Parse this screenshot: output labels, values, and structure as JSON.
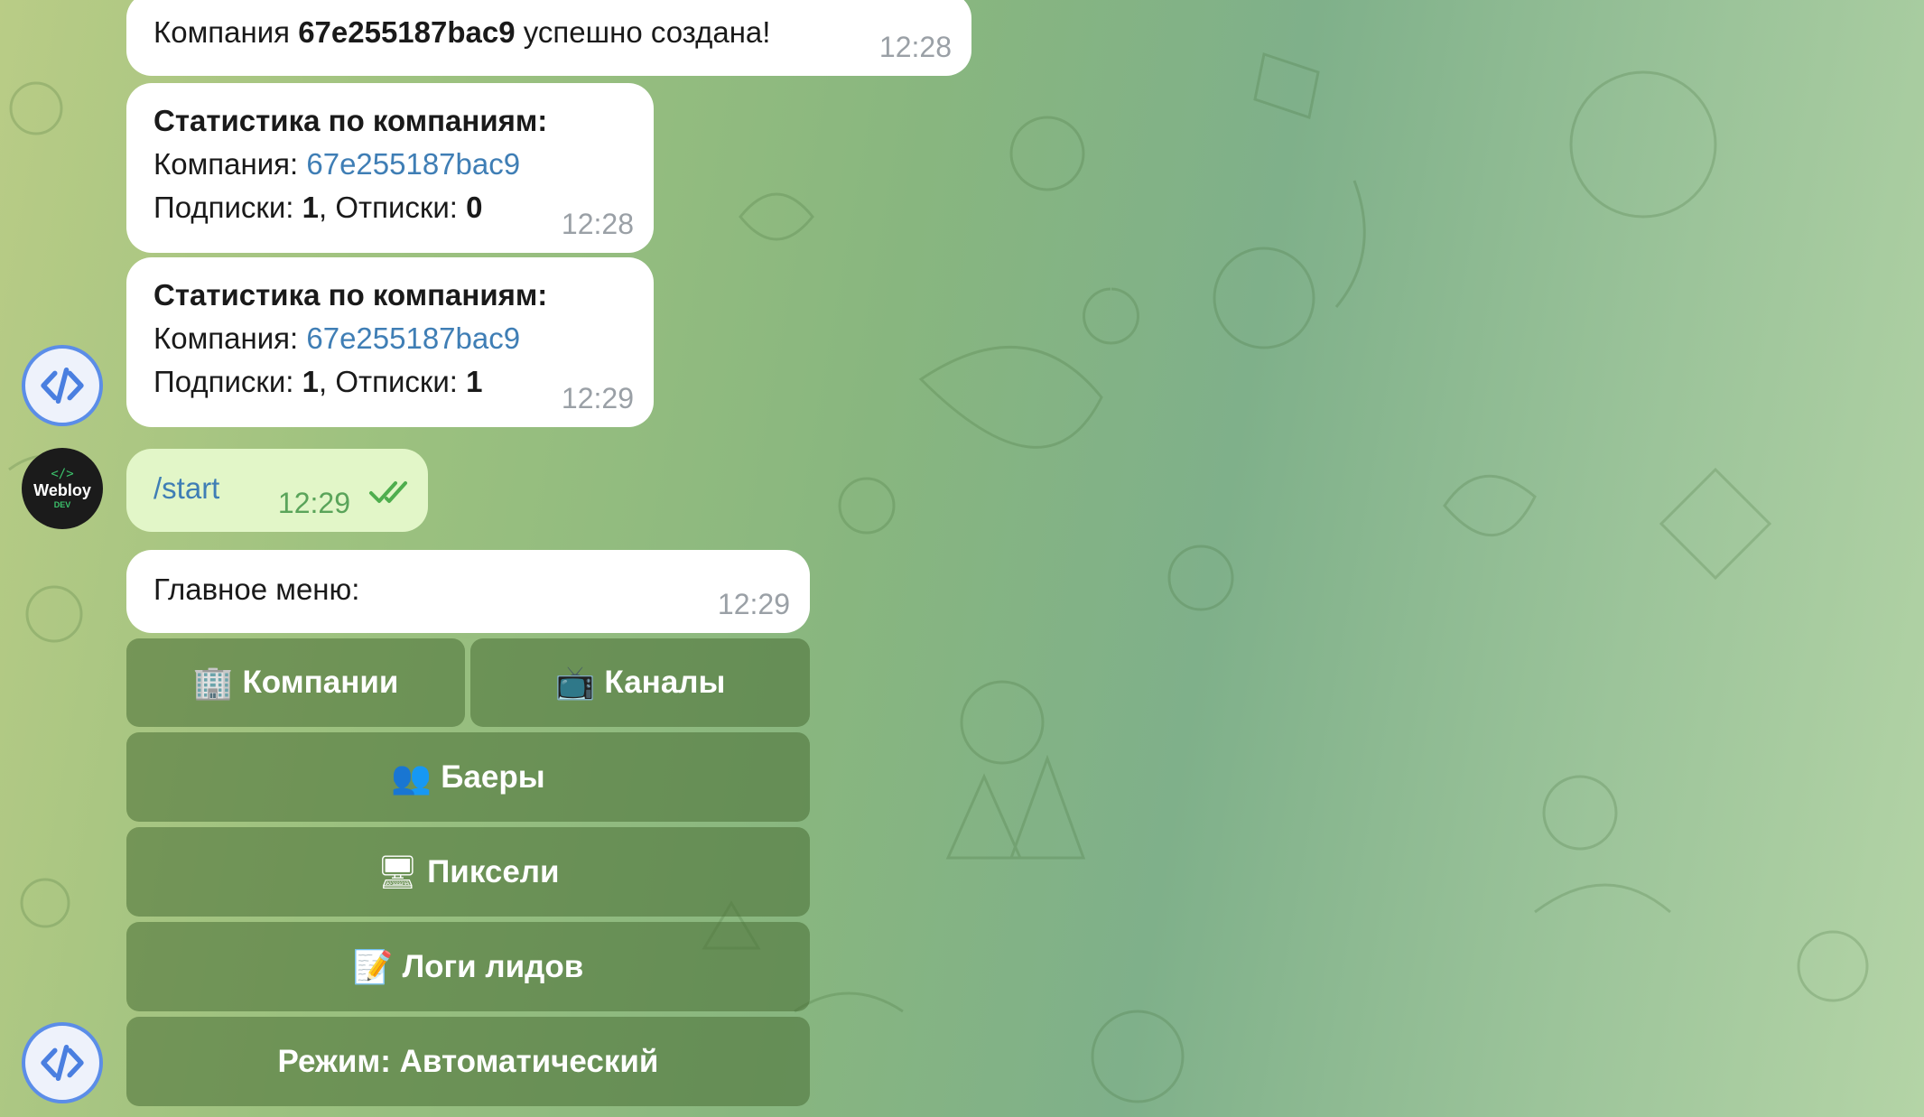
{
  "messages": [
    {
      "id": "created",
      "prefix": "Компания ",
      "company_id": "67e255187bac9",
      "suffix": " успешно создана!",
      "time": "12:28"
    },
    {
      "id": "stats1",
      "title": "Статистика по компаниям:",
      "company_label": "Компания: ",
      "company_link": "67e255187bac9",
      "subs_label": "Подписки: ",
      "subs": "1",
      "unsubs_label": ", Отписки: ",
      "unsubs": "0",
      "time": "12:28"
    },
    {
      "id": "stats2",
      "title": "Статистика по компаниям:",
      "company_label": "Компания: ",
      "company_link": "67e255187bac9",
      "subs_label": "Подписки: ",
      "subs": "1",
      "unsubs_label": ", Отписки: ",
      "unsubs": "1",
      "time": "12:29"
    },
    {
      "id": "start",
      "text": "/start",
      "time": "12:29",
      "status": "✓✓"
    },
    {
      "id": "menu",
      "text": "Главное меню:",
      "time": "12:29"
    }
  ],
  "user_avatar": {
    "logo": "</>",
    "name": "Webloy",
    "sub": "DEV"
  },
  "keyboard": {
    "companies": {
      "emoji": "🏢",
      "label": "Компании"
    },
    "channels": {
      "emoji": "📺",
      "label": "Каналы"
    },
    "buyers": {
      "emoji": "👥",
      "label": "Баеры"
    },
    "pixels": {
      "emoji": "🖥",
      "label": "Пиксели"
    },
    "leads_logs": {
      "emoji": "📝",
      "label": "Логи лидов"
    },
    "mode": {
      "label": "Режим: Автоматический"
    }
  },
  "colors": {
    "incoming_bubble": "#ffffff",
    "outgoing_bubble": "#e2f6c8",
    "link": "#3f7eb5",
    "keyboard_button": "#486e34",
    "bot_avatar_ring": "#5b8de8"
  }
}
